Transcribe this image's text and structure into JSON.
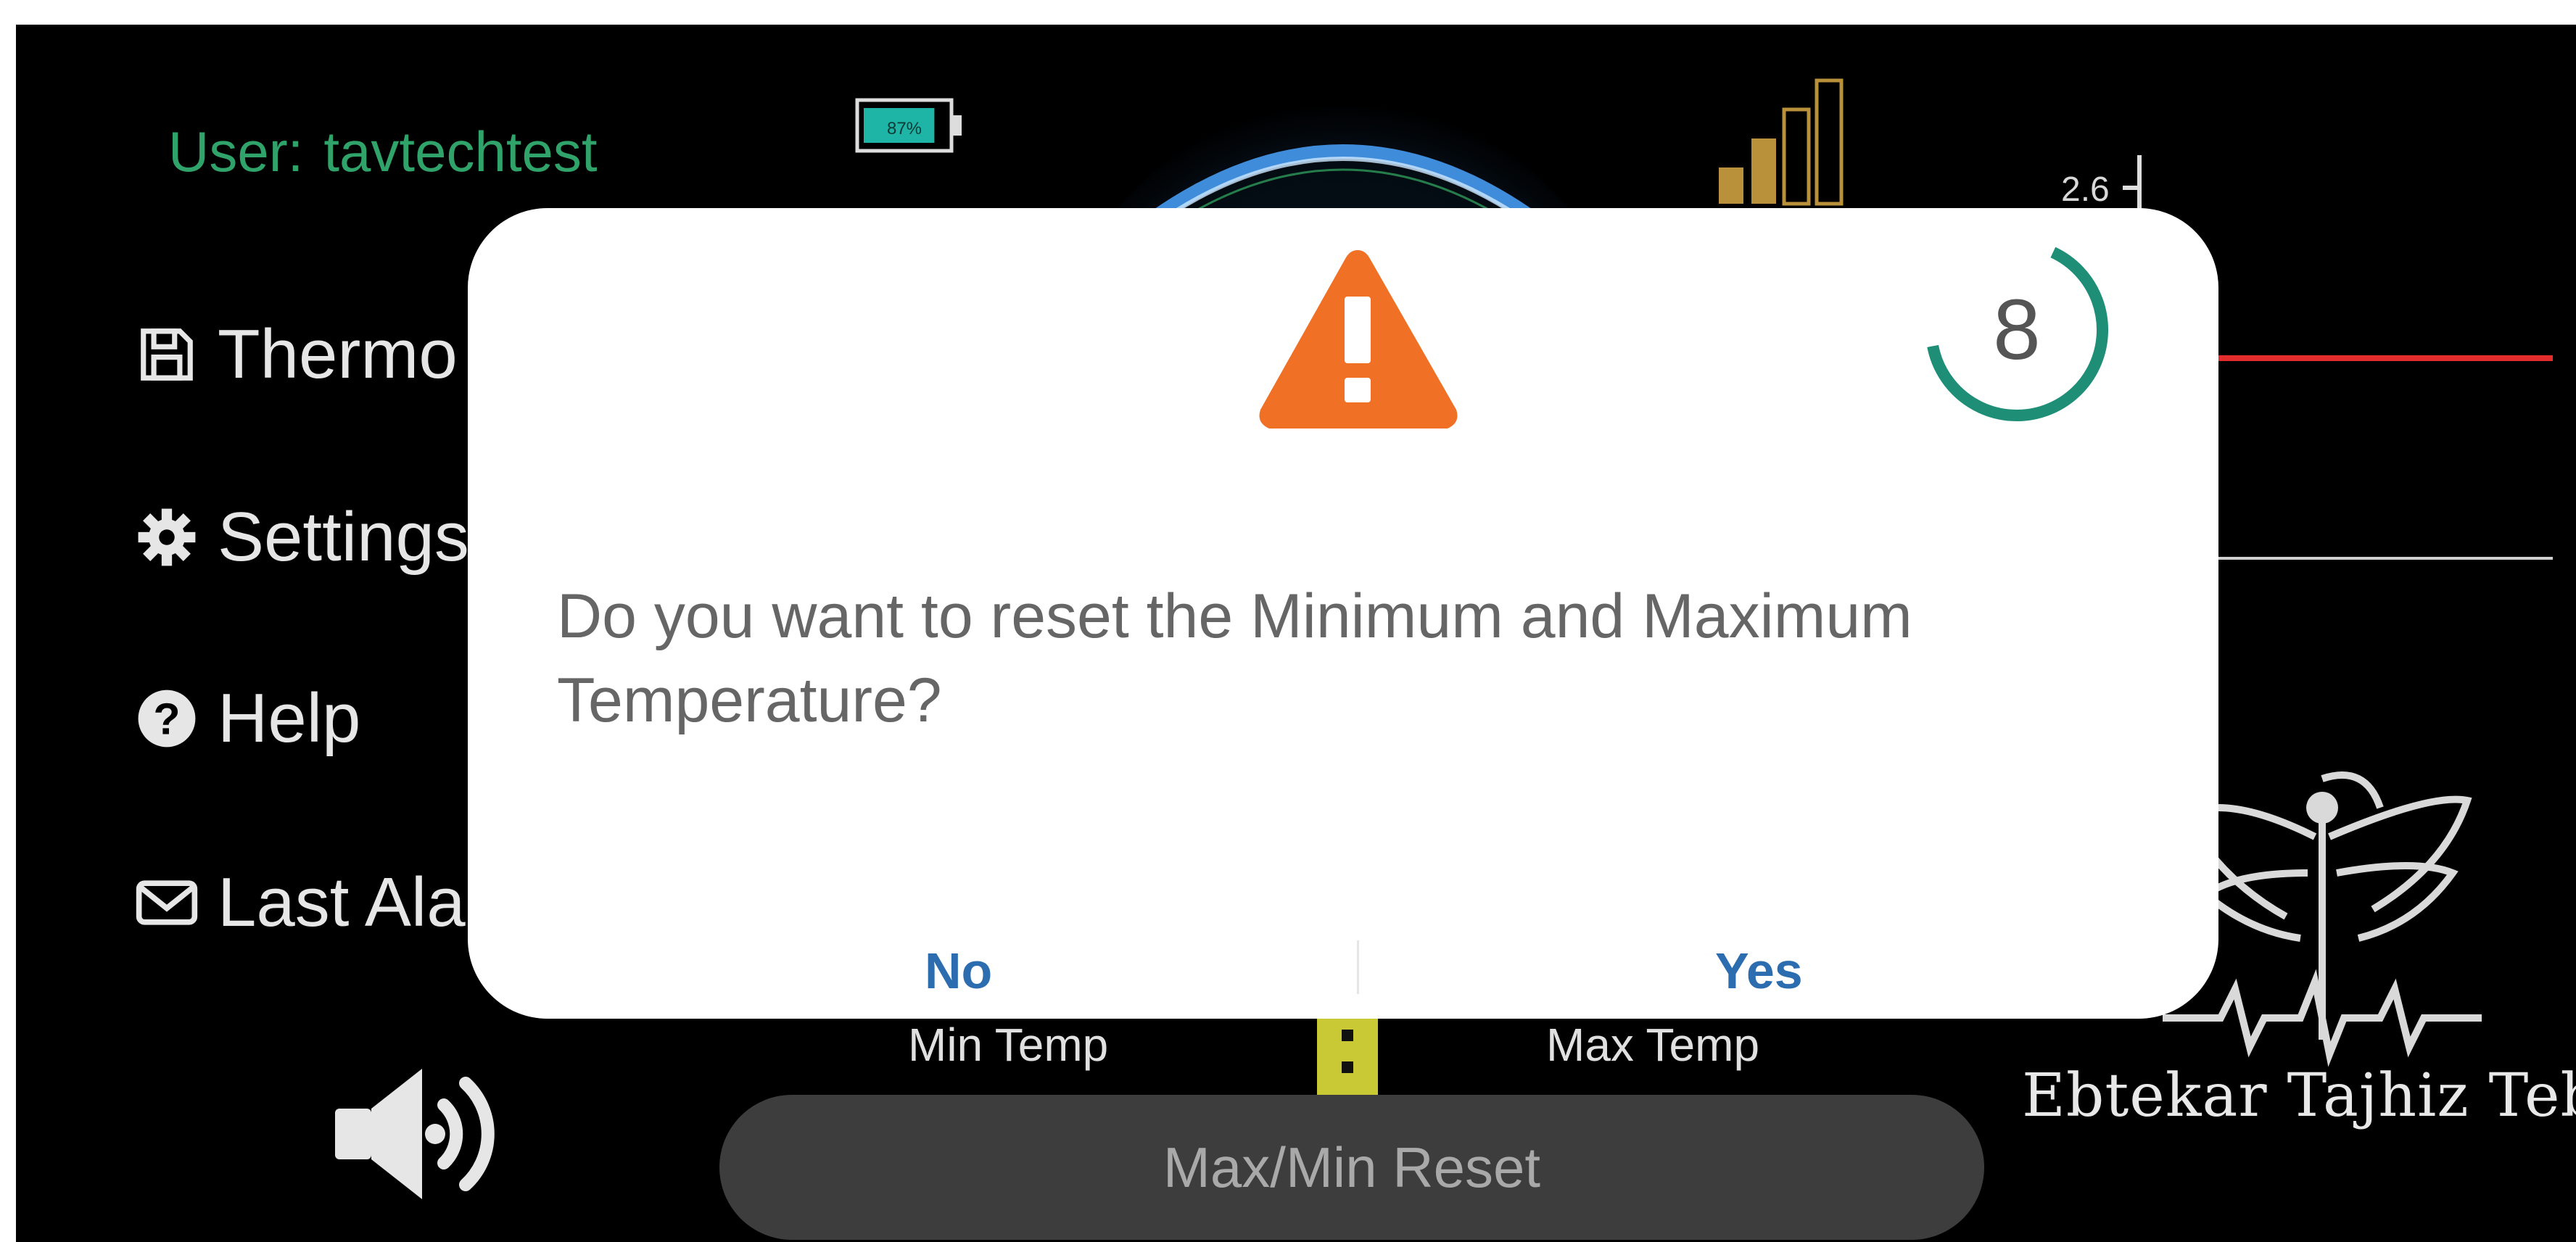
{
  "header": {
    "user_label": "User:",
    "username": "tavtechtest",
    "battery_percent": "87%",
    "battery_level": 0.87,
    "signal_bars": 4,
    "signal_active_bars": 2,
    "axis_value": "2.6"
  },
  "menu": {
    "items": [
      {
        "label": "Thermo",
        "icon": "save-icon"
      },
      {
        "label": "Settings",
        "icon": "gear-icon"
      },
      {
        "label": "Help",
        "icon": "question-icon"
      },
      {
        "label": "Last Ala",
        "icon": "envelope-icon"
      }
    ]
  },
  "main": {
    "min_temp_label": "Min Temp",
    "max_temp_label": "Max Temp",
    "reset_button": "Max/Min Reset"
  },
  "branding": {
    "company": "Ebtekar Tajhiz Teb"
  },
  "dialog": {
    "countdown": "8",
    "countdown_progress": 0.65,
    "message_line1": "Do you want to reset the Minimum and Maximum",
    "message_line2": "Temperature?",
    "no_label": "No",
    "yes_label": "Yes"
  },
  "colors": {
    "accent_green": "#2fa36a",
    "warning_orange": "#f07126",
    "button_blue": "#2c6db0",
    "countdown_teal": "#1e8e77",
    "chart_red": "#e32d2d"
  }
}
